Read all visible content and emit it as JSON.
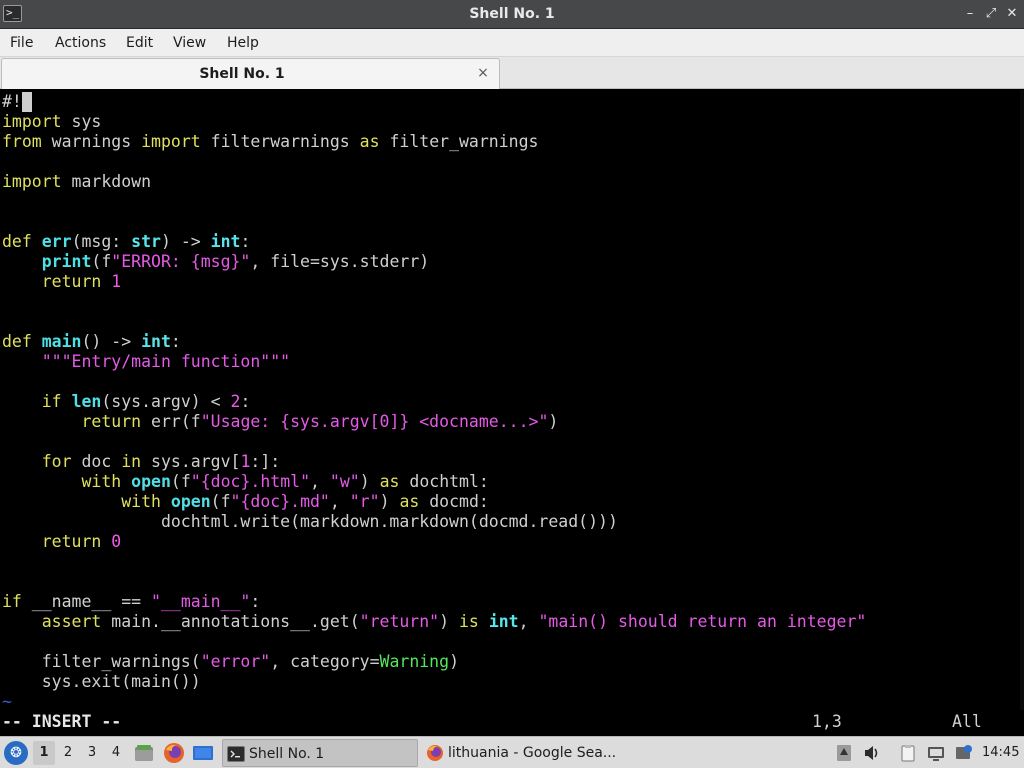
{
  "window": {
    "title": "Shell No. 1"
  },
  "menu": [
    "File",
    "Actions",
    "Edit",
    "View",
    "Help"
  ],
  "tab": {
    "label": "Shell No. 1",
    "close": "×"
  },
  "editor": {
    "lines": [
      [
        {
          "t": "#!",
          "c": ""
        }
      ],
      [
        {
          "t": "import",
          "c": "kw"
        },
        {
          "t": " sys",
          "c": ""
        }
      ],
      [
        {
          "t": "from",
          "c": "kw"
        },
        {
          "t": " warnings ",
          "c": ""
        },
        {
          "t": "import",
          "c": "kw"
        },
        {
          "t": " filterwarnings ",
          "c": ""
        },
        {
          "t": "as",
          "c": "kw"
        },
        {
          "t": " filter_warnings",
          "c": ""
        }
      ],
      [],
      [
        {
          "t": "import",
          "c": "kw"
        },
        {
          "t": " markdown",
          "c": ""
        }
      ],
      [],
      [],
      [
        {
          "t": "def",
          "c": "kw"
        },
        {
          "t": " ",
          "c": ""
        },
        {
          "t": "err",
          "c": "fn"
        },
        {
          "t": "(msg: ",
          "c": ""
        },
        {
          "t": "str",
          "c": "ty"
        },
        {
          "t": ") -> ",
          "c": ""
        },
        {
          "t": "int",
          "c": "ty"
        },
        {
          "t": ":",
          "c": ""
        }
      ],
      [
        {
          "t": "    ",
          "c": ""
        },
        {
          "t": "print",
          "c": "fn"
        },
        {
          "t": "(f",
          "c": ""
        },
        {
          "t": "\"ERROR: {msg}\"",
          "c": "st"
        },
        {
          "t": ", file=sys.stderr)",
          "c": ""
        }
      ],
      [
        {
          "t": "    ",
          "c": ""
        },
        {
          "t": "return",
          "c": "kw"
        },
        {
          "t": " ",
          "c": ""
        },
        {
          "t": "1",
          "c": "nu"
        }
      ],
      [],
      [],
      [
        {
          "t": "def",
          "c": "kw"
        },
        {
          "t": " ",
          "c": ""
        },
        {
          "t": "main",
          "c": "fn"
        },
        {
          "t": "() -> ",
          "c": ""
        },
        {
          "t": "int",
          "c": "ty"
        },
        {
          "t": ":",
          "c": ""
        }
      ],
      [
        {
          "t": "    ",
          "c": ""
        },
        {
          "t": "\"\"\"Entry/main function\"\"\"",
          "c": "st"
        }
      ],
      [],
      [
        {
          "t": "    ",
          "c": ""
        },
        {
          "t": "if",
          "c": "kw"
        },
        {
          "t": " ",
          "c": ""
        },
        {
          "t": "len",
          "c": "fn"
        },
        {
          "t": "(sys.argv) < ",
          "c": ""
        },
        {
          "t": "2",
          "c": "nu"
        },
        {
          "t": ":",
          "c": ""
        }
      ],
      [
        {
          "t": "        ",
          "c": ""
        },
        {
          "t": "return",
          "c": "kw"
        },
        {
          "t": " err(f",
          "c": ""
        },
        {
          "t": "\"Usage: {sys.argv[0]} <docname...>\"",
          "c": "st"
        },
        {
          "t": ")",
          "c": ""
        }
      ],
      [],
      [
        {
          "t": "    ",
          "c": ""
        },
        {
          "t": "for",
          "c": "kw"
        },
        {
          "t": " doc ",
          "c": ""
        },
        {
          "t": "in",
          "c": "kw"
        },
        {
          "t": " sys.argv[",
          "c": ""
        },
        {
          "t": "1",
          "c": "nu"
        },
        {
          "t": ":]:",
          "c": ""
        }
      ],
      [
        {
          "t": "        ",
          "c": ""
        },
        {
          "t": "with",
          "c": "kw"
        },
        {
          "t": " ",
          "c": ""
        },
        {
          "t": "open",
          "c": "fn"
        },
        {
          "t": "(f",
          "c": ""
        },
        {
          "t": "\"{doc}.html\"",
          "c": "st"
        },
        {
          "t": ", ",
          "c": ""
        },
        {
          "t": "\"w\"",
          "c": "st"
        },
        {
          "t": ") ",
          "c": ""
        },
        {
          "t": "as",
          "c": "kw"
        },
        {
          "t": " dochtml:",
          "c": ""
        }
      ],
      [
        {
          "t": "            ",
          "c": ""
        },
        {
          "t": "with",
          "c": "kw"
        },
        {
          "t": " ",
          "c": ""
        },
        {
          "t": "open",
          "c": "fn"
        },
        {
          "t": "(f",
          "c": ""
        },
        {
          "t": "\"{doc}.md\"",
          "c": "st"
        },
        {
          "t": ", ",
          "c": ""
        },
        {
          "t": "\"r\"",
          "c": "st"
        },
        {
          "t": ") ",
          "c": ""
        },
        {
          "t": "as",
          "c": "kw"
        },
        {
          "t": " docmd:",
          "c": ""
        }
      ],
      [
        {
          "t": "                dochtml.write(markdown.markdown(docmd.read()))",
          "c": ""
        }
      ],
      [
        {
          "t": "    ",
          "c": ""
        },
        {
          "t": "return",
          "c": "kw"
        },
        {
          "t": " ",
          "c": ""
        },
        {
          "t": "0",
          "c": "nu"
        }
      ],
      [],
      [],
      [
        {
          "t": "if",
          "c": "kw"
        },
        {
          "t": " __name__ == ",
          "c": ""
        },
        {
          "t": "\"__main__\"",
          "c": "st"
        },
        {
          "t": ":",
          "c": ""
        }
      ],
      [
        {
          "t": "    ",
          "c": ""
        },
        {
          "t": "assert",
          "c": "kw"
        },
        {
          "t": " main.__annotations__.get(",
          "c": ""
        },
        {
          "t": "\"return\"",
          "c": "st"
        },
        {
          "t": ") ",
          "c": ""
        },
        {
          "t": "is",
          "c": "kw"
        },
        {
          "t": " ",
          "c": ""
        },
        {
          "t": "int",
          "c": "ty"
        },
        {
          "t": ", ",
          "c": ""
        },
        {
          "t": "\"main() should return an integer\"",
          "c": "st"
        }
      ],
      [],
      [
        {
          "t": "    filter_warnings(",
          "c": ""
        },
        {
          "t": "\"error\"",
          "c": "st"
        },
        {
          "t": ", category=",
          "c": ""
        },
        {
          "t": "Warning",
          "c": "gr"
        },
        {
          "t": ")",
          "c": ""
        }
      ],
      [
        {
          "t": "    sys.exit(main())",
          "c": ""
        }
      ],
      [
        {
          "t": "~",
          "c": "tilde"
        }
      ]
    ],
    "status_mode": "-- INSERT --",
    "status_pos": "1,3",
    "status_scroll": "All"
  },
  "taskbar": {
    "workspaces": [
      "1",
      "2",
      "3",
      "4"
    ],
    "tasks": [
      {
        "label": "Shell No. 1",
        "icon": "terminal-icon"
      },
      {
        "label": "lithuania - Google Sea...",
        "icon": "firefox-icon"
      }
    ],
    "clock": "14:45"
  },
  "colors": {
    "keyword": "#e0e060",
    "function": "#4fe0e6",
    "string": "#e55ae6",
    "number": "#ef5de8",
    "builtin_class": "#53e65c",
    "tilde": "#3a5bd1"
  }
}
